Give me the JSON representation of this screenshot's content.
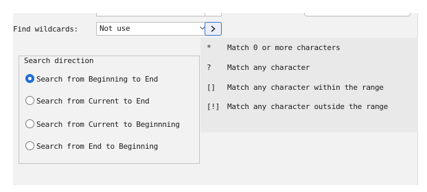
{
  "find_wildcards": {
    "label": "Find wildcards:",
    "selected": "Not use"
  },
  "wildcards": [
    {
      "symbol": "*",
      "desc": "Match 0 or more characters"
    },
    {
      "symbol": "?",
      "desc": "Match any character"
    },
    {
      "symbol": "[]",
      "desc": "Match any character within the range"
    },
    {
      "symbol": "[!]",
      "desc": "Match any character outside the range"
    }
  ],
  "search_direction": {
    "title": "Search direction",
    "options": [
      {
        "label": "Search from Beginning to End",
        "selected": true
      },
      {
        "label": "Search from Current to End",
        "selected": false
      },
      {
        "label": "Search from Current to Beginnning",
        "selected": false
      },
      {
        "label": "Search from End to Beginning",
        "selected": false
      }
    ]
  },
  "colors": {
    "accent": "#1f6fd1",
    "panel": "#f2f2f2",
    "wildcard_bg": "#e9e9e9"
  },
  "icons": {
    "dropdown": "chevron-down-icon",
    "expand": "chevron-right-icon"
  }
}
